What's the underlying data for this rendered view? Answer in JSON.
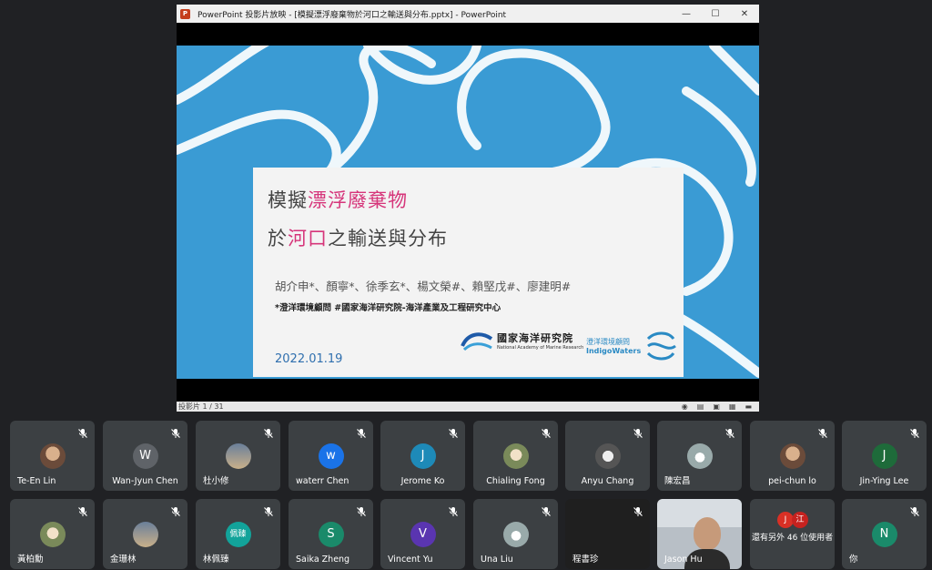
{
  "ppt": {
    "app_icon": "P",
    "title": "PowerPoint 投影片放映 - [模擬漂浮廢棄物於河口之輸送與分布.pptx] - PowerPoint",
    "minimize": "—",
    "maximize": "☐",
    "close": "✕",
    "slide_count": "投影片 1 / 31",
    "status_icons": [
      "◉",
      "▤",
      "▣",
      "▦",
      "▬"
    ]
  },
  "slide": {
    "title_line1_pre": "模擬",
    "title_line1_hl": "漂浮廢棄物",
    "title_line2_pre": "於",
    "title_line2_hl": "河口",
    "title_line2_post": "之輸送與分布",
    "authors": "胡介申*、顏寧*、徐季玄*、楊文榮#、賴堅戊#、廖建明#",
    "affiliation": "*澄洋環境顧問  #國家海洋研究院-海洋產業及工程研究中心",
    "date": "2022.01.19",
    "logo_narl_cn": "國家海洋研究院",
    "logo_narl_en": "National Academy of Marine Research",
    "logo_iw_cn": "澄洋環境顧問",
    "logo_iw_en": "IndigoWaters",
    "accent_pink": "#d6357a",
    "bg_blue": "#3a9bd4"
  },
  "participants_row1": [
    {
      "name": "Te-En Lin",
      "initial": "",
      "style": "photo"
    },
    {
      "name": "Wan-Jyun Chen",
      "initial": "W",
      "color": "#5f6368"
    },
    {
      "name": "杜小修",
      "initial": "",
      "style": "photo5"
    },
    {
      "name": "waterr Chen",
      "initial": "w",
      "color": "#1a73e8"
    },
    {
      "name": "Jerome Ko",
      "initial": "J",
      "color": "#1e8ab8"
    },
    {
      "name": "Chialing Fong",
      "initial": "",
      "style": "photo2"
    },
    {
      "name": "Anyu Chang",
      "initial": "",
      "style": "photo3"
    },
    {
      "name": "陳宏昌",
      "initial": "",
      "style": "photo4"
    },
    {
      "name": "pei-chun lo",
      "initial": "",
      "style": "photo"
    },
    {
      "name": "Jin-Ying Lee",
      "initial": "J",
      "color": "#1e6b3a"
    }
  ],
  "participants_row2": [
    {
      "name": "黃柏勳",
      "initial": "",
      "style": "photo2"
    },
    {
      "name": "金珊林",
      "initial": "",
      "style": "photo5"
    },
    {
      "name": "林佩臻",
      "initial": "佩臻",
      "color": "#12a39a"
    },
    {
      "name": "Saika Zheng",
      "initial": "S",
      "color": "#1a8a6a"
    },
    {
      "name": "Vincent Yu",
      "initial": "V",
      "color": "#5a35b0"
    },
    {
      "name": "Una Liu",
      "initial": "",
      "style": "photo4"
    },
    {
      "name": "程書珍",
      "initial": "",
      "color": ""
    }
  ],
  "jason": {
    "name": "Jason Hu"
  },
  "more": {
    "av1": "J",
    "av2": "江",
    "text": "還有另外 46 位使用者"
  },
  "you": {
    "name": "你",
    "initial": "N",
    "color": "#1a8a6a"
  }
}
